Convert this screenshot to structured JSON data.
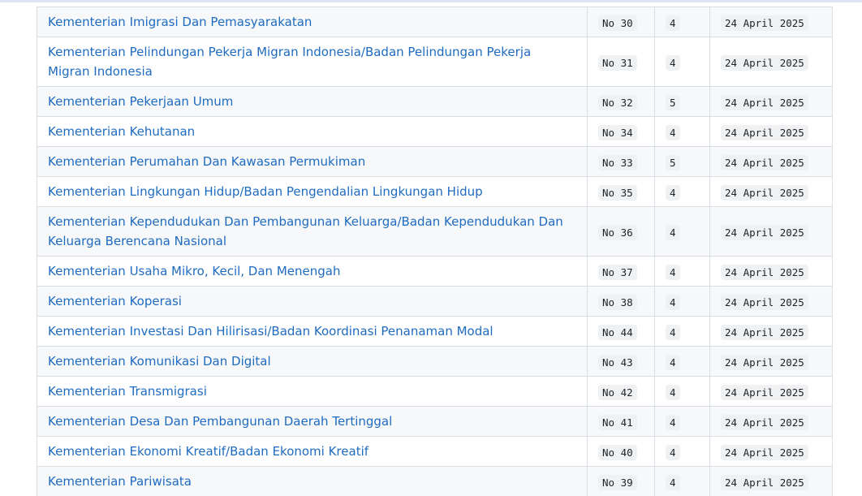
{
  "table": {
    "rows": [
      {
        "name": "Kementerian Imigrasi Dan Pemasyarakatan",
        "number": "No 30",
        "revision": "4",
        "date": "24 April 2025"
      },
      {
        "name": "Kementerian Pelindungan Pekerja Migran Indonesia/Badan Pelindungan Pekerja Migran Indonesia",
        "number": "No 31",
        "revision": "4",
        "date": "24 April 2025"
      },
      {
        "name": "Kementerian Pekerjaan Umum",
        "number": "No 32",
        "revision": "5",
        "date": "24 April 2025"
      },
      {
        "name": "Kementerian Kehutanan",
        "number": "No 34",
        "revision": "4",
        "date": "24 April 2025"
      },
      {
        "name": "Kementerian Perumahan Dan Kawasan Permukiman",
        "number": "No 33",
        "revision": "5",
        "date": "24 April 2025"
      },
      {
        "name": "Kementerian Lingkungan Hidup/Badan Pengendalian Lingkungan Hidup",
        "number": "No 35",
        "revision": "4",
        "date": "24 April 2025"
      },
      {
        "name": "Kementerian Kependudukan Dan Pembangunan Keluarga/Badan Kependudukan Dan Keluarga Berencana Nasional",
        "number": "No 36",
        "revision": "4",
        "date": "24 April 2025"
      },
      {
        "name": "Kementerian Usaha Mikro, Kecil, Dan Menengah",
        "number": "No 37",
        "revision": "4",
        "date": "24 April 2025"
      },
      {
        "name": "Kementerian Koperasi",
        "number": "No 38",
        "revision": "4",
        "date": "24 April 2025"
      },
      {
        "name": "Kementerian Investasi Dan Hilirisasi/Badan Koordinasi Penanaman Modal",
        "number": "No 44",
        "revision": "4",
        "date": "24 April 2025"
      },
      {
        "name": "Kementerian Komunikasi Dan Digital",
        "number": "No 43",
        "revision": "4",
        "date": "24 April 2025"
      },
      {
        "name": "Kementerian Transmigrasi",
        "number": "No 42",
        "revision": "4",
        "date": "24 April 2025"
      },
      {
        "name": "Kementerian Desa Dan Pembangunan Daerah Tertinggal",
        "number": "No 41",
        "revision": "4",
        "date": "24 April 2025"
      },
      {
        "name": "Kementerian Ekonomi Kreatif/Badan Ekonomi Kreatif",
        "number": "No 40",
        "revision": "4",
        "date": "24 April 2025"
      },
      {
        "name": "Kementerian Pariwisata",
        "number": "No 39",
        "revision": "4",
        "date": "24 April 2025"
      }
    ]
  },
  "colors": {
    "link": "#1f6bc0",
    "row_alt": "#f6f8fa",
    "border": "#d8dee4",
    "code_bg": "#eff1f3"
  }
}
